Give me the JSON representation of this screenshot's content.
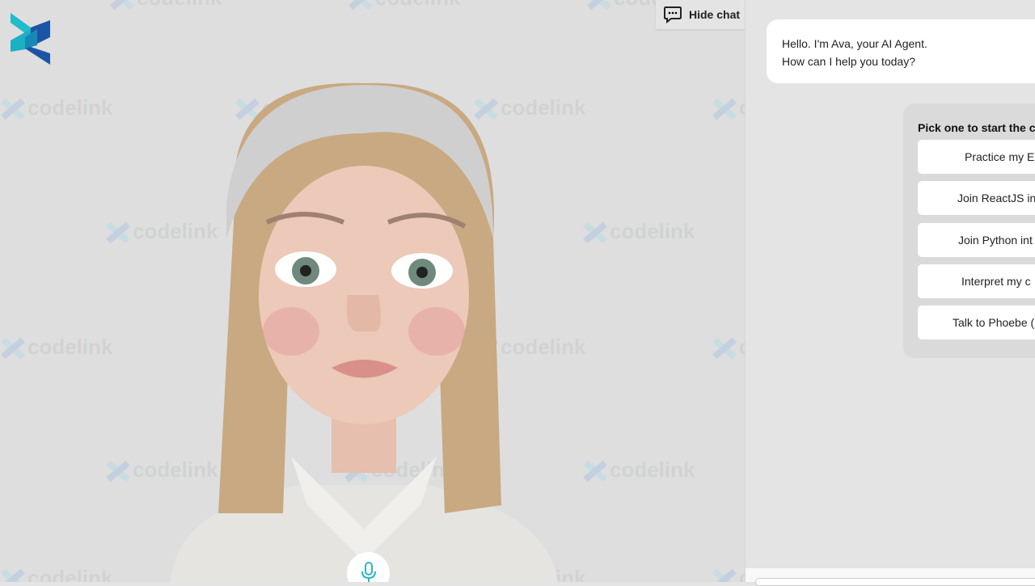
{
  "brand": {
    "watermark_text": "codelink",
    "colors": {
      "teal": "#1fb8c9",
      "blue": "#1d55a6",
      "mic": "#29b6c8"
    }
  },
  "header": {
    "hide_chat_label": "Hide chat",
    "hide_chat_icon": "chat-bubble-icon"
  },
  "chat": {
    "messages": [
      {
        "sender": "agent",
        "lines": [
          "Hello. I'm Ava, your AI Agent.",
          "How can I help you today?"
        ]
      }
    ],
    "picker": {
      "title": "Pick one to start the c",
      "options": [
        "Practice my E",
        "Join ReactJS in",
        "Join Python int",
        "Interpret my c",
        "Talk to Phoebe ("
      ]
    }
  },
  "controls": {
    "mic_icon": "microphone-icon"
  }
}
